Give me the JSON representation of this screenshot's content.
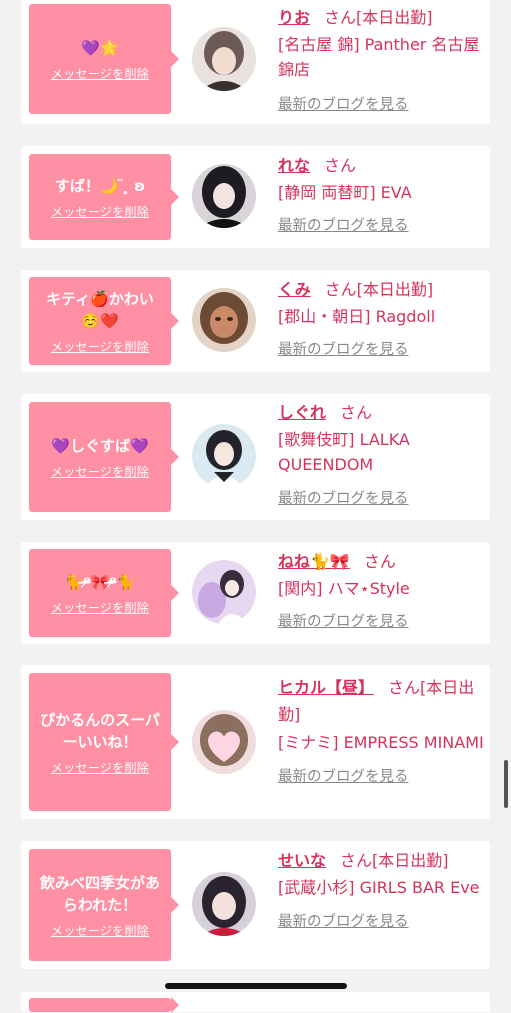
{
  "cards": [
    {
      "message": "💜🌟",
      "delete_label": "メッセージを削除",
      "name": "りお",
      "suffix": "さん[本日出勤]",
      "shop": "[名古屋 錦] Panther 名古屋錦店",
      "blog_label": "最新のブログを見る",
      "avatar_icon": "photo-avatar",
      "avatar_color": "#6b5a55"
    },
    {
      "message": "すば！🌙 ̈ ̥ ʚ",
      "delete_label": "メッセージを削除",
      "name": "れな",
      "suffix": "さん",
      "shop": "[静岡 両替町] EVA",
      "blog_label": "最新のブログを見る",
      "avatar_icon": "photo-avatar",
      "avatar_color": "#2a2a2e"
    },
    {
      "message": "キティ🍎かわい☺️❤️",
      "delete_label": "メッセージを削除",
      "name": "くみ",
      "suffix": "さん[本日出勤]",
      "shop": "[郡山・朝日] Ragdoll",
      "blog_label": "最新のブログを見る",
      "avatar_icon": "photo-avatar",
      "avatar_color": "#b9785c"
    },
    {
      "message": "💜しぐすば💜",
      "delete_label": "メッセージを削除",
      "name": "しぐれ",
      "suffix": "さん",
      "shop": "[歌舞伎町] LALKA QUEENDOM",
      "blog_label": "最新のブログを見る",
      "avatar_icon": "photo-avatar",
      "avatar_color": "#cfe2ee"
    },
    {
      "message": "🐈ᵒ̴̶̷🎀ᵒ̴̶̷🐈",
      "delete_label": "メッセージを削除",
      "name": "ねね🐈🎀",
      "suffix": "さん",
      "shop": "[関内] ハマ⋆Style",
      "blog_label": "最新のブログを見る",
      "avatar_icon": "photo-avatar",
      "avatar_color": "#d9c6e8"
    },
    {
      "message": "ぴかるんのスーパーいいね！",
      "delete_label": "メッセージを削除",
      "name": "ヒカル【昼】",
      "suffix": "さん[本日出勤]",
      "shop": "[ミナミ] EMPRESS MINAMI",
      "blog_label": "最新のブログを見る",
      "avatar_icon": "heart-avatar",
      "avatar_color": "#f3d4da"
    },
    {
      "message": "飲みべ四季女があらわれた！",
      "delete_label": "メッセージを削除",
      "name": "せいな",
      "suffix": "さん[本日出勤]",
      "shop": "[武蔵小杉] GIRLS BAR Eve",
      "blog_label": "最新のブログを見る",
      "avatar_icon": "photo-avatar",
      "avatar_color": "#3a3440"
    }
  ],
  "theme": {
    "accent": "#d6335c",
    "bubble": "#ff8fa3",
    "background": "#f2f2f2",
    "link_gray": "#888888"
  }
}
